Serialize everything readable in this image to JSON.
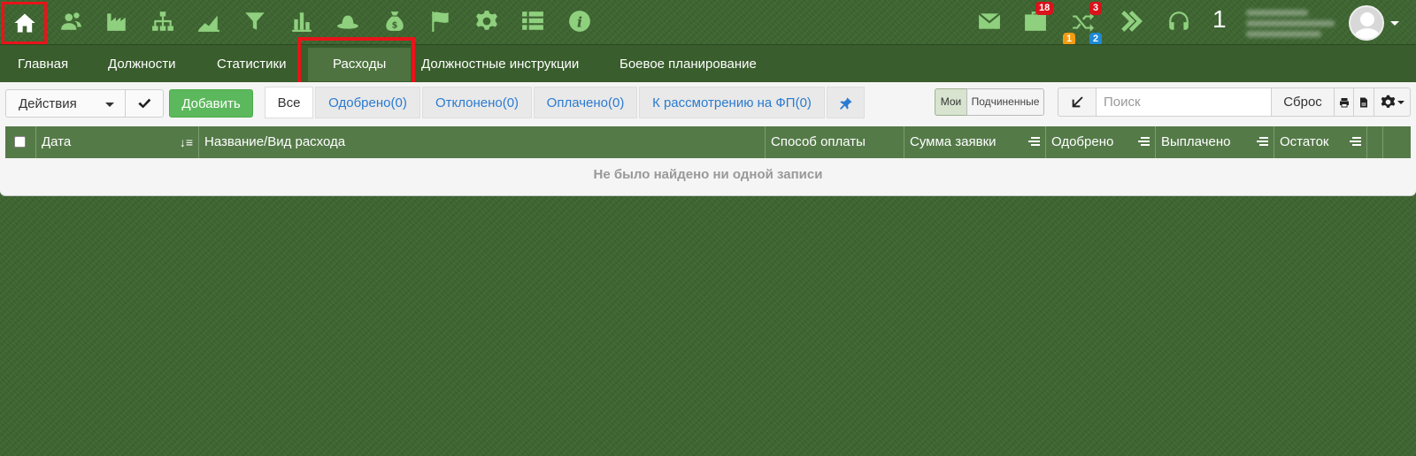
{
  "topbar": {
    "icons": [
      "home-icon",
      "users-icon",
      "factory-icon",
      "org-chart-icon",
      "area-chart-icon",
      "filter-icon",
      "bar-chart-icon",
      "hat-icon",
      "money-bag-icon",
      "flag-icon",
      "gear-icon",
      "list-icon",
      "info-icon"
    ],
    "right": {
      "messages_icon": "envelope-icon",
      "briefcase_badge": "18",
      "shuffle_badge_top": "3",
      "shuffle_badge_orange": "1",
      "shuffle_badge_blue": "2",
      "big_number": "1"
    }
  },
  "nav": {
    "tabs": [
      "Главная",
      "Должности",
      "Статистики",
      "Расходы",
      "Должностные инструкции",
      "Боевое планирование"
    ],
    "active": "Расходы"
  },
  "toolbar": {
    "actions_label": "Действия",
    "add_label": "Добавить",
    "filters": [
      "Все",
      "Одобрено(0)",
      "Отклонено(0)",
      "Оплачено(0)",
      "К рассмотрению на ФП(0)"
    ],
    "toggle_mine": "Мои",
    "toggle_sub": "Подчиненные",
    "search_placeholder": "Поиск",
    "reset_label": "Сброс"
  },
  "table": {
    "columns": [
      "Дата",
      "Название/Вид расхода",
      "Способ оплаты",
      "Сумма заявки",
      "Одобрено",
      "Выплачено",
      "Остаток"
    ],
    "empty_message": "Не было найдено ни одной записи"
  },
  "colors": {
    "background": "#3d6530",
    "icon_green": "#8fd07f",
    "header_green": "#547a48",
    "highlight_red": "#e8141a",
    "add_button": "#5cb85c"
  }
}
